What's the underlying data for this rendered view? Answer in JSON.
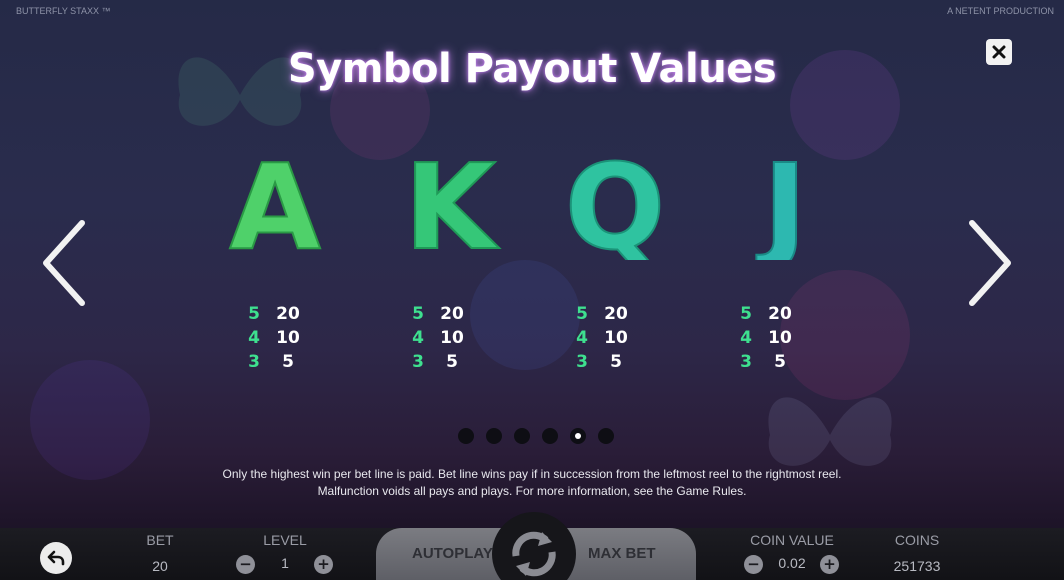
{
  "topbar": {
    "game_name": "BUTTERFLY STAXX ™",
    "provider": "A NETENT PRODUCTION"
  },
  "title": "Symbol Payout Values",
  "symbols": [
    {
      "letter": "A",
      "color": "#4fd16a",
      "pays": [
        {
          "count": "5",
          "value": "20"
        },
        {
          "count": "4",
          "value": "10"
        },
        {
          "count": "3",
          "value": "5"
        }
      ]
    },
    {
      "letter": "K",
      "color": "#35c778",
      "pays": [
        {
          "count": "5",
          "value": "20"
        },
        {
          "count": "4",
          "value": "10"
        },
        {
          "count": "3",
          "value": "5"
        }
      ]
    },
    {
      "letter": "Q",
      "color": "#2fc3a0",
      "pays": [
        {
          "count": "5",
          "value": "20"
        },
        {
          "count": "4",
          "value": "10"
        },
        {
          "count": "3",
          "value": "5"
        }
      ]
    },
    {
      "letter": "J",
      "color": "#2db8b0",
      "pays": [
        {
          "count": "5",
          "value": "20"
        },
        {
          "count": "4",
          "value": "10"
        },
        {
          "count": "3",
          "value": "5"
        }
      ]
    }
  ],
  "pagination": {
    "total": 6,
    "current": 5
  },
  "rules": {
    "line1": "Only the highest win per bet line is paid. Bet line wins pay if in succession from the leftmost reel to the rightmost reel.",
    "line2": "Malfunction voids all pays and plays. For more information, see the Game Rules."
  },
  "controls": {
    "bet_label": "BET",
    "bet_value": "20",
    "level_label": "LEVEL",
    "level_value": "1",
    "autoplay_label": "AUTOPLAY",
    "maxbet_label": "MAX BET",
    "coin_value_label": "COIN VALUE",
    "coin_value": "0.02",
    "coins_label": "COINS",
    "coins_value": "251733",
    "minus_symbol": "−",
    "plus_symbol": "+"
  },
  "icons": {
    "close": "close-icon",
    "prev": "chevron-left-icon",
    "next": "chevron-right-icon",
    "back": "back-arrow-icon",
    "spin": "spin-icon"
  },
  "colors": {
    "count_green": "#3ee08f",
    "title_glow": "#d68cff"
  }
}
